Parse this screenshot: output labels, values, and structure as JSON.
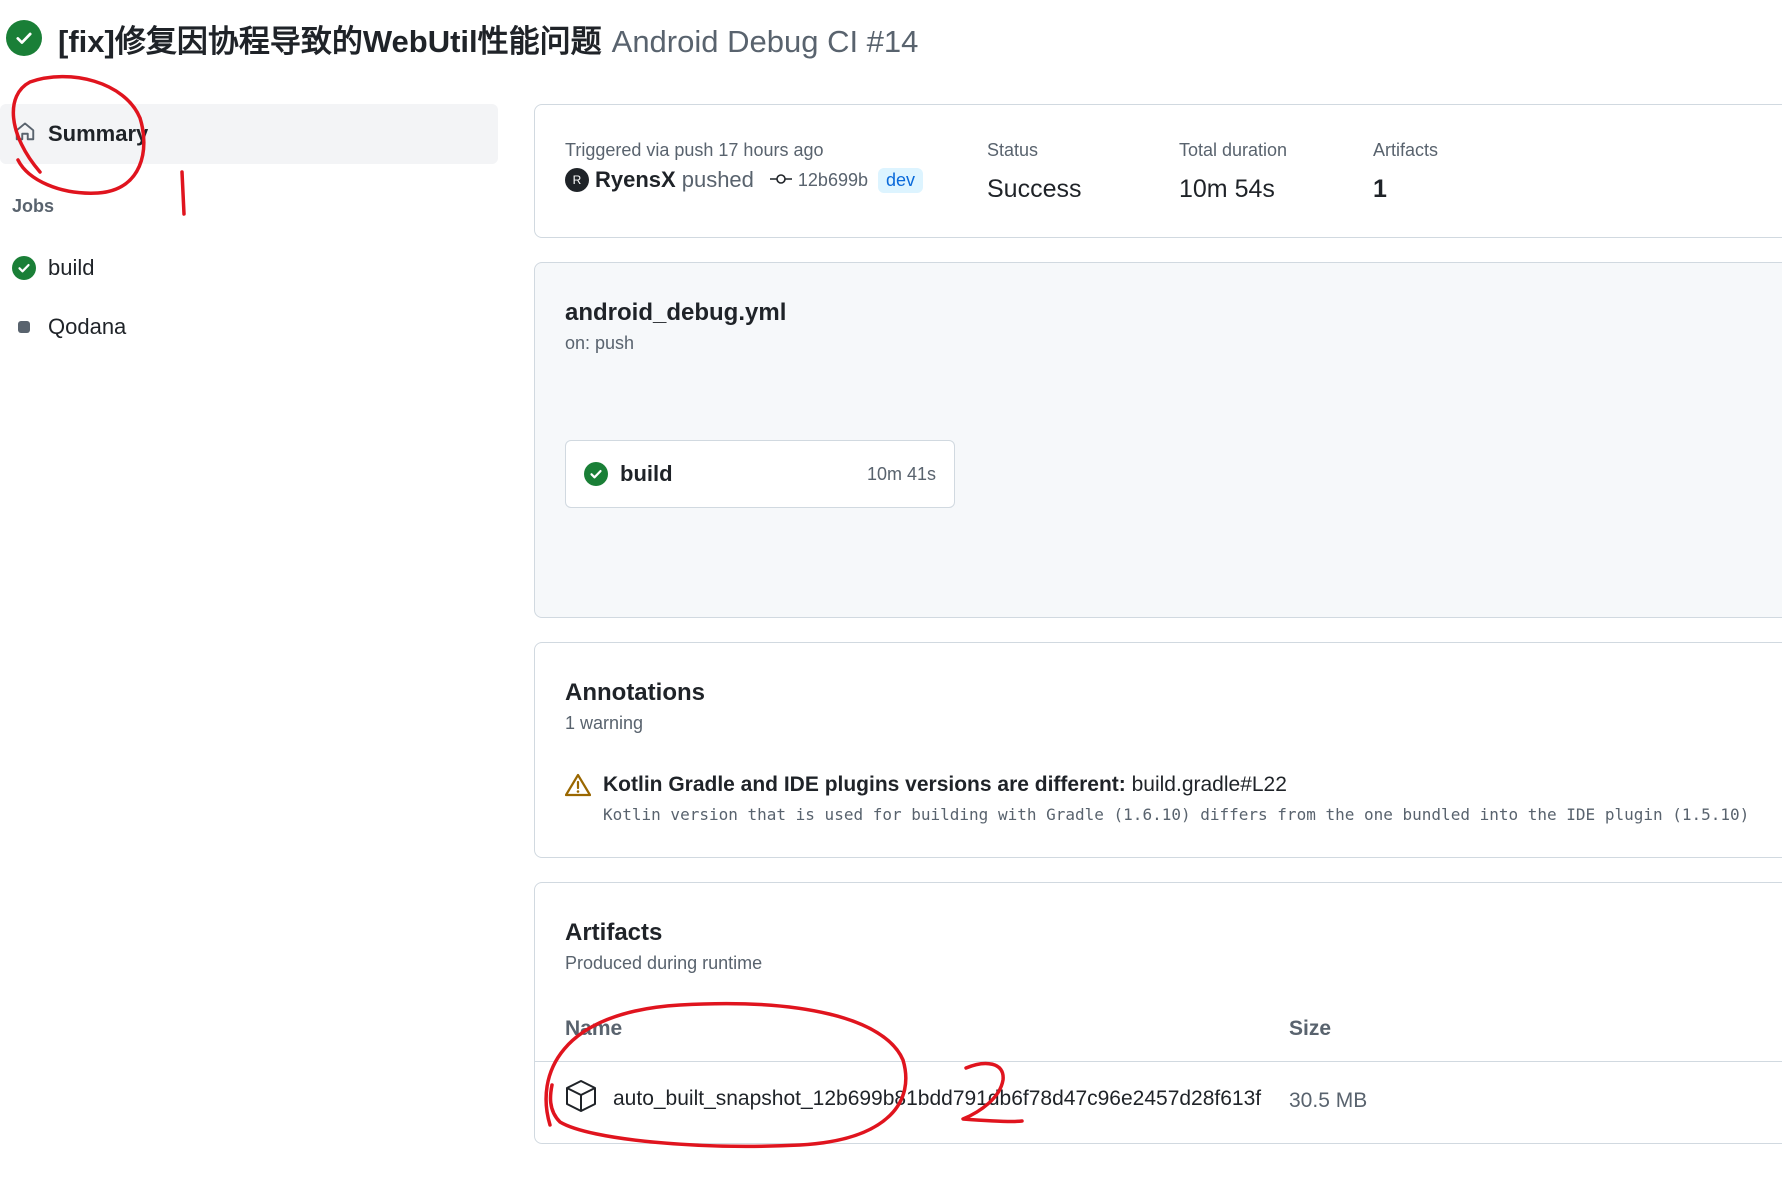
{
  "header": {
    "title": "[fix]修复因协程导致的WebUtil性能问题",
    "workflow": "Android Debug CI #14",
    "status_icon": "check-circle-icon",
    "accent": "#1a7f37"
  },
  "sidebar": {
    "summary_label": "Summary",
    "jobs_label": "Jobs",
    "jobs": [
      {
        "label": "build",
        "state": "success"
      },
      {
        "label": "Qodana",
        "state": "pending"
      }
    ]
  },
  "run": {
    "trigger": "Triggered via push 17 hours ago",
    "actor": "RyensX",
    "action": "pushed",
    "commit": "12b699b",
    "branch": "dev",
    "status_label": "Status",
    "status_value": "Success",
    "duration_label": "Total duration",
    "duration_value": "10m 54s",
    "artifacts_label": "Artifacts",
    "artifacts_value": "1"
  },
  "workflow_card": {
    "file": "android_debug.yml",
    "event": "on: push",
    "job_name": "build",
    "job_duration": "10m 41s"
  },
  "annotations": {
    "title": "Annotations",
    "count": "1 warning",
    "headline": "Kotlin Gradle and IDE plugins versions are different:",
    "location": "build.gradle#L22",
    "message": "Kotlin version that is used for building with Gradle (1.6.10) differs from the one bundled into the IDE plugin (1.5.10)"
  },
  "artifacts": {
    "title": "Artifacts",
    "subtitle": "Produced during runtime",
    "col_name": "Name",
    "col_size": "Size",
    "items": [
      {
        "name": "auto_built_snapshot_12b699b81bdd791db6f78d47c96e2457d28f613f",
        "size": "30.5 MB"
      }
    ]
  },
  "markup_annotations": {
    "mark_1": "1",
    "mark_2": "2",
    "color": "#e0141e"
  }
}
